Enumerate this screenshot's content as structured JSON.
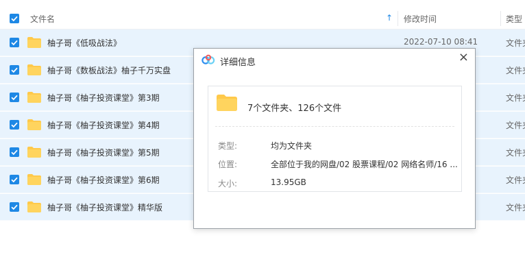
{
  "header": {
    "name_label": "文件名",
    "modified_label": "修改时间",
    "type_label": "类型",
    "sort_arrow": "↑"
  },
  "rows": [
    {
      "name": "柚子哥《低吸战法》",
      "modified": "2022-07-10 08:41",
      "type": "文件夹"
    },
    {
      "name": "柚子哥《数板战法》柚子千万实盘",
      "modified": "",
      "type": "文件夹"
    },
    {
      "name": "柚子哥《柚子投资课堂》第3期",
      "modified": "",
      "type": "文件夹"
    },
    {
      "name": "柚子哥《柚子投资课堂》第4期",
      "modified": "",
      "type": "文件夹"
    },
    {
      "name": "柚子哥《柚子投资课堂》第5期",
      "modified": "",
      "type": "文件夹"
    },
    {
      "name": "柚子哥《柚子投资课堂》第6期",
      "modified": "",
      "type": "文件夹"
    },
    {
      "name": "柚子哥《柚子投资课堂》精华版",
      "modified": "",
      "type": "文件夹"
    }
  ],
  "dialog": {
    "title": "详细信息",
    "close": "×",
    "summary": "7个文件夹、126个文件",
    "type_label": "类型:",
    "type_value": "均为文件夹",
    "location_label": "位置:",
    "location_value": "全部位于我的网盘/02 股票课程/02 网络名师/16 ...",
    "size_label": "大小:",
    "size_value": "13.95GB"
  },
  "colors": {
    "accent": "#1e88e5",
    "row_selected": "#e8f3fd",
    "folder": "#ffc94a"
  },
  "icons": {
    "checkbox": "checked-checkbox-icon",
    "folder": "folder-icon",
    "logo": "cloud-logo-icon",
    "close": "close-icon",
    "sort": "sort-ascending-icon"
  }
}
